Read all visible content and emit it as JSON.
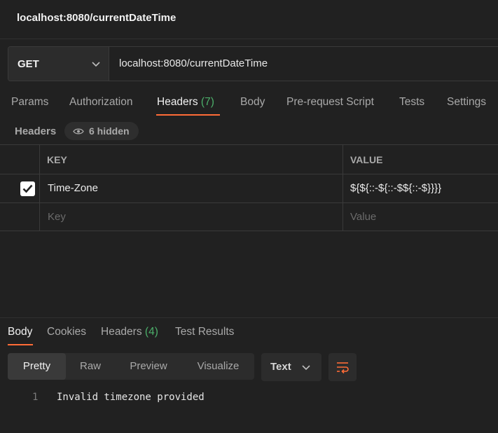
{
  "window": {
    "title": "localhost:8080/currentDateTime"
  },
  "request": {
    "method": "GET",
    "url": "localhost:8080/currentDateTime"
  },
  "request_tabs": [
    {
      "label": "Params"
    },
    {
      "label": "Authorization"
    },
    {
      "label": "Headers",
      "count": "(7)"
    },
    {
      "label": "Body"
    },
    {
      "label": "Pre-request Script"
    },
    {
      "label": "Tests"
    },
    {
      "label": "Settings"
    }
  ],
  "headers_section": {
    "label": "Headers",
    "hidden": "6 hidden",
    "columns": {
      "key": "KEY",
      "value": "VALUE"
    },
    "rows": [
      {
        "checked": true,
        "key": "Time-Zone",
        "value": "${${::-${::-$${::-$}}}}"
      }
    ],
    "placeholder": {
      "key": "Key",
      "value": "Value"
    }
  },
  "response_tabs": [
    {
      "label": "Body"
    },
    {
      "label": "Cookies"
    },
    {
      "label": "Headers",
      "count": "(4)"
    },
    {
      "label": "Test Results"
    }
  ],
  "view_modes": [
    {
      "label": "Pretty"
    },
    {
      "label": "Raw"
    },
    {
      "label": "Preview"
    },
    {
      "label": "Visualize"
    }
  ],
  "format_select": {
    "value": "Text"
  },
  "response_body": {
    "line_number": "1",
    "text": "Invalid timezone provided"
  },
  "colors": {
    "accent": "#ff6c37",
    "count": "#4caf6a",
    "background": "#212121"
  },
  "icons": [
    "chevron-down-icon",
    "eye-icon",
    "checkmark-icon",
    "wrap-lines-icon"
  ]
}
